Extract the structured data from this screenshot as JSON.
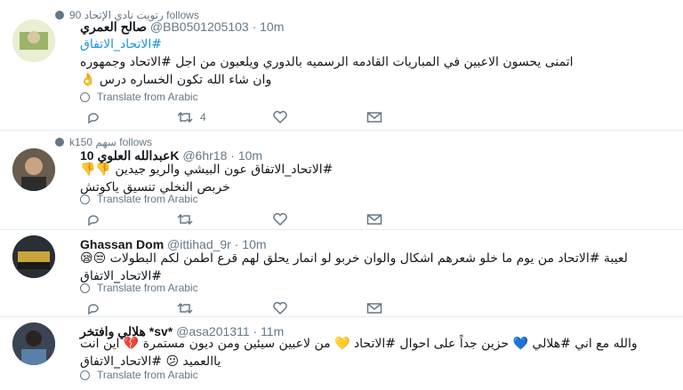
{
  "tweets": [
    {
      "context": "90 رتويت نادي الإتحاد follows",
      "name": "صالح العمري",
      "handle": "@BB0501205103",
      "time": "10m",
      "lines": [
        "#الاتحاد_الاتفاق",
        "اتمنى يحسون الاعبين في المباريات القادمه الرسميه بالدوري ويلعبون من اجل #الاتحاد وجمهوره",
        "وان شاء الله تكون الخساره درس 👌"
      ],
      "translate": "Translate from Arabic",
      "retweets": "4",
      "avatar_color": "#c8d6a0"
    },
    {
      "context": "k150 سهم follows",
      "name": "عبدالله العلوي 10K",
      "handle": "@6hr18",
      "time": "10m",
      "lines": [
        "#الاتحاد_الاتفاق عون البيشي والريو جيدين 👎👎",
        "خربص النخلي تنسيق ياكوتش"
      ],
      "translate": "Translate from Arabic",
      "retweets": "",
      "avatar_color": "#4a4036"
    },
    {
      "context": "",
      "name": "Ghassan Dom",
      "handle": "@ittihad_9r",
      "time": "10m",
      "lines": [
        "لعيبة #الاتحاد من يوم ما خلو شعرهم اشكال والوان خربو لو انمار يحلق لهم قرع اطمن لكم البطولات 😒😪 #الاتحاد_الاتفاق"
      ],
      "translate": "Translate from Arabic",
      "retweets": "",
      "avatar_color": "#2a2e35"
    },
    {
      "context": "",
      "name": "هلالي وافتخر *sv*",
      "handle": "@asa201311",
      "time": "11m",
      "lines": [
        "والله مع اني #هلالي 💙 حزين جداً على احوال #الاتحاد 💛 من لاعبين سيئين ومن ديون مستمرة 💔 اين انت ياالعميد 😕 #الاتحاد_الاتفاق"
      ],
      "translate": "Translate from Arabic",
      "retweets": "",
      "avatar_color": "#3b4452"
    }
  ],
  "icons": {
    "reply": "reply-icon",
    "retweet": "retweet-icon",
    "like": "heart-icon",
    "dm": "envelope-icon",
    "translate": "globe-icon",
    "follows": "user-icon"
  }
}
